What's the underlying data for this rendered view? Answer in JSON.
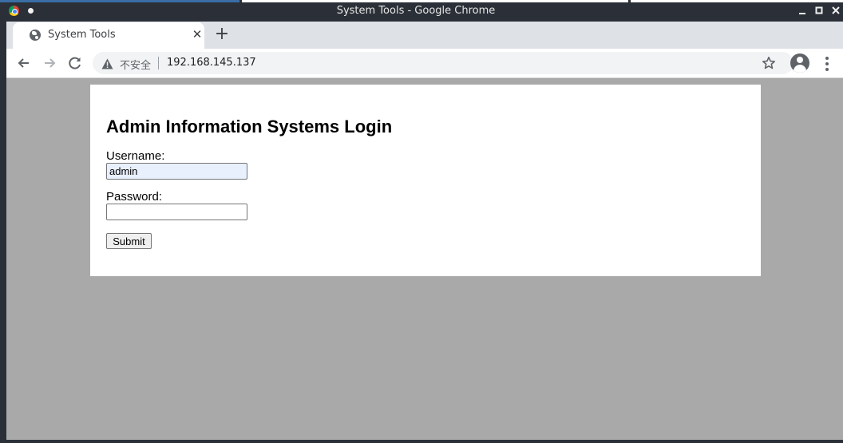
{
  "window": {
    "title": "System Tools - Google Chrome",
    "controls": [
      "minimize",
      "maximize",
      "close"
    ]
  },
  "tab": {
    "title": "System Tools",
    "close_glyph": "✕",
    "icon": "globe-icon"
  },
  "newtab_glyph": "+",
  "toolbar": {
    "security_label": "不安全",
    "url": "192.168.145.137"
  },
  "form": {
    "heading": "Admin Information Systems Login",
    "username_label": "Username:",
    "username_value": "admin",
    "password_label": "Password:",
    "password_value": "",
    "submit_label": "Submit"
  },
  "colors": {
    "page_background": "#a9a9a9",
    "autofill_background": "#e8f0fe",
    "titlebar": "#2b3038"
  }
}
